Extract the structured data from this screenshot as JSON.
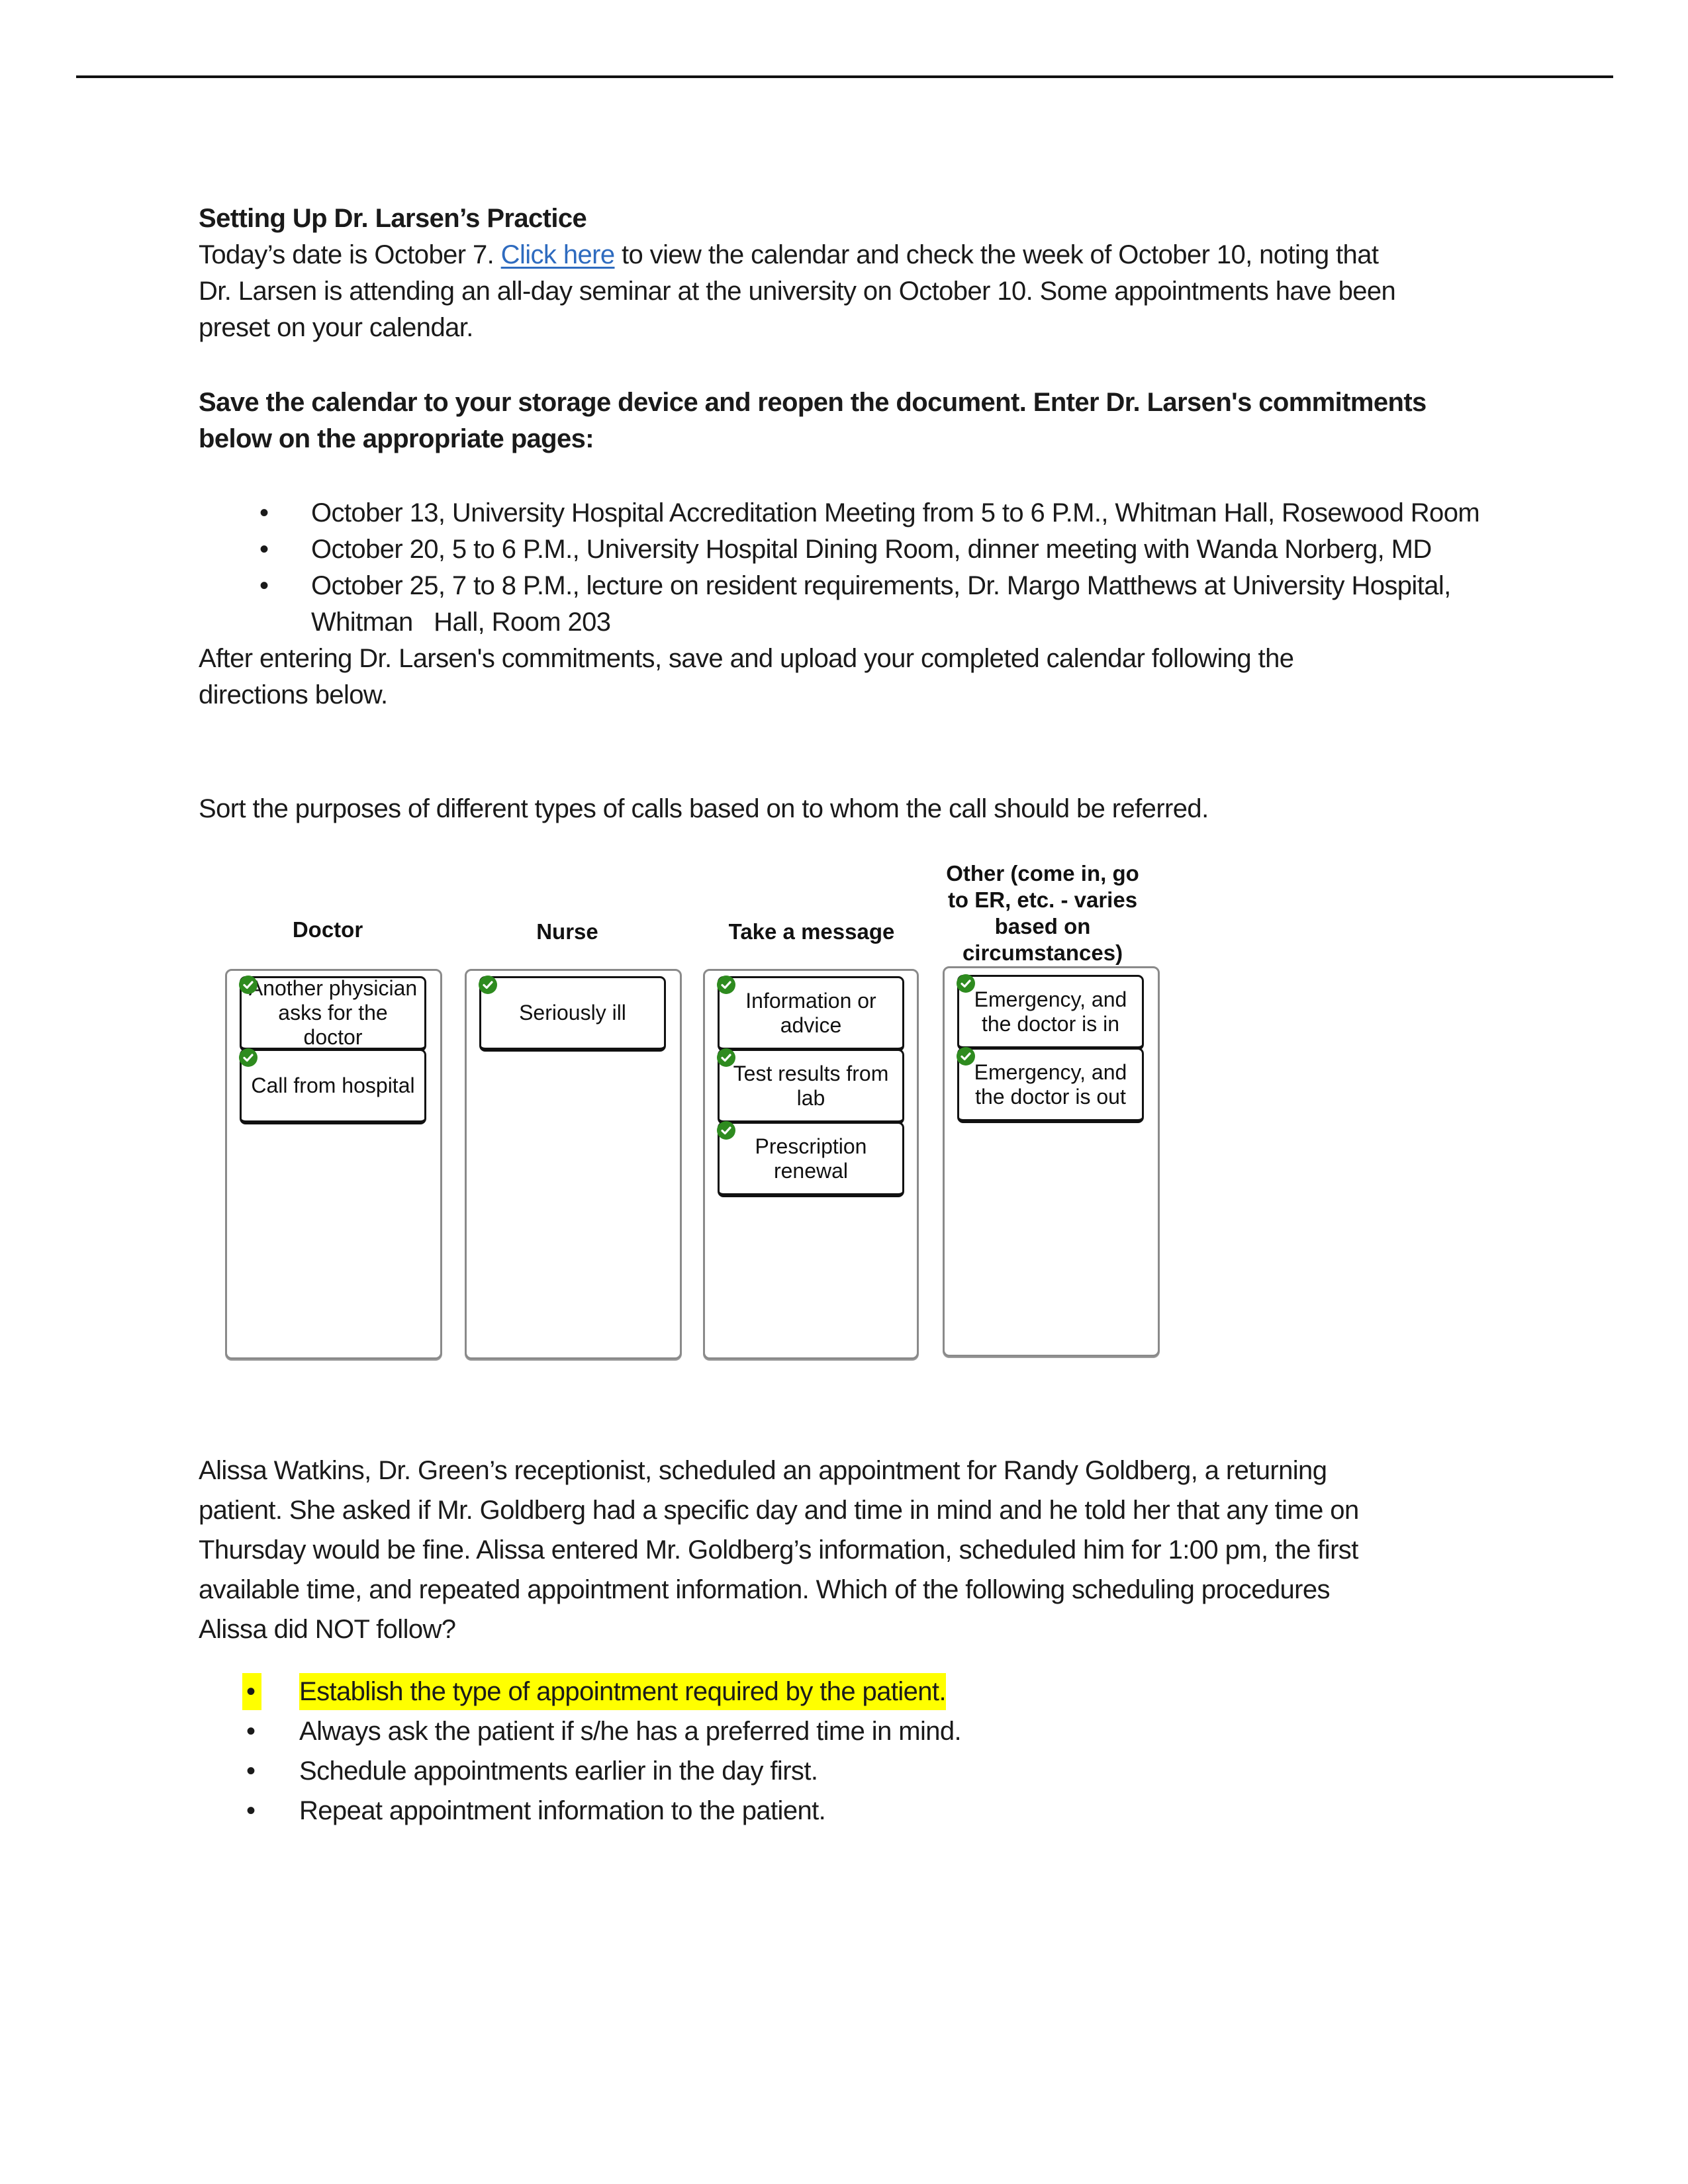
{
  "document": {
    "title": "Setting Up Dr. Larsen’s Practice",
    "intro": {
      "before_link": "Today’s date is October 7. ",
      "link_text": "Click here",
      "after_link_line1": " to view the calendar and check the week of October 10, noting that",
      "line2": "Dr. Larsen is attending an all-day seminar at the university on October 10. Some appointments have been",
      "line3": "preset on your calendar."
    },
    "instruction_bold": {
      "line1": "Save the calendar to your storage device and reopen the document. Enter Dr. Larsen's commitments",
      "line2": "below on the appropriate pages:"
    },
    "commitments": [
      {
        "bullet": "•",
        "text": "October 13, University Hospital Accreditation Meeting from 5 to 6 P.M., Whitman Hall, Rosewood Room"
      },
      {
        "bullet": "•",
        "text": "October 20, 5 to 6 P.M., University Hospital Dining Room, dinner meeting with Wanda Norberg, MD"
      },
      {
        "bullet": "•",
        "text": "October 25, 7 to 8 P.M., lecture on resident requirements, Dr. Margo Matthews at University Hospital,",
        "continuation": "Whitman   Hall, Room 203"
      }
    ],
    "after_entering": {
      "line1": "After entering Dr. Larsen's commitments, save and upload your completed calendar following the",
      "line2": "directions below."
    },
    "sort_prompt": "Sort the purposes of different types of calls based on to whom the call should be referred.",
    "sort_exercise": {
      "check_icon_color": "#2e8b1f",
      "columns": [
        {
          "heading": [
            "Doctor"
          ],
          "cards": [
            [
              "Another physician",
              "asks for the doctor"
            ],
            [
              "Call from hospital"
            ]
          ]
        },
        {
          "heading": [
            "Nurse"
          ],
          "cards": [
            [
              "Seriously ill"
            ]
          ]
        },
        {
          "heading": [
            "Take a message"
          ],
          "cards": [
            [
              "Information or",
              "advice"
            ],
            [
              "Test results from",
              "lab"
            ],
            [
              "Prescription",
              "renewal"
            ]
          ]
        },
        {
          "heading": [
            "Other (come in, go",
            "to ER, etc. - varies",
            "based on",
            "circumstances)"
          ],
          "cards": [
            [
              "Emergency, and",
              "the doctor is in"
            ],
            [
              "Emergency, and",
              "the doctor is out"
            ]
          ]
        }
      ]
    },
    "scenario": {
      "lines": [
        "Alissa Watkins, Dr. Green’s receptionist, scheduled an appointment for Randy Goldberg, a returning",
        "patient. She asked if Mr. Goldberg had a specific day and time in mind and he told her that any time on",
        "Thursday would be fine. Alissa entered Mr. Goldberg’s information, scheduled him for 1:00 pm, the first",
        "available time, and repeated appointment information. Which of the following scheduling procedures",
        "Alissa did NOT follow?"
      ]
    },
    "answer_options": [
      {
        "bullet": "•",
        "text": "Establish the type of appointment required by the patient.",
        "highlighted": true,
        "highlight_color": "#ffff00"
      },
      {
        "bullet": "•",
        "text": "Always ask the patient if s/he has a preferred time in mind.",
        "highlighted": false
      },
      {
        "bullet": "•",
        "text": "Schedule appointments earlier in the day first.",
        "highlighted": false
      },
      {
        "bullet": "•",
        "text": "Repeat appointment information to the patient.",
        "highlighted": false
      }
    ]
  }
}
